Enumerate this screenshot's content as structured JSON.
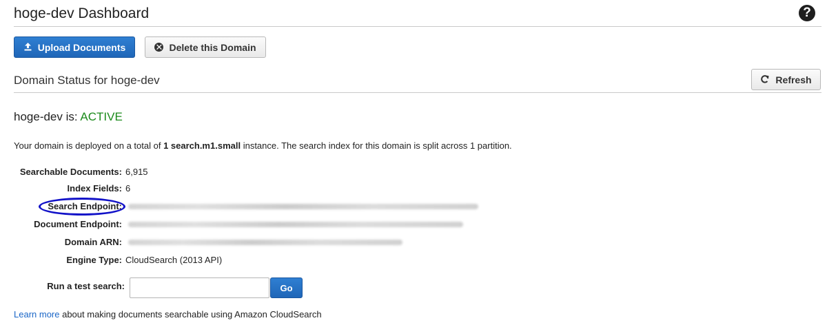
{
  "header": {
    "title": "hoge-dev Dashboard",
    "help_icon": "?"
  },
  "toolbar": {
    "upload_label": "Upload Documents",
    "delete_label": "Delete this Domain",
    "upload_icon": "upload-icon",
    "delete_icon": "circle-x-icon"
  },
  "domain_status": {
    "section_title": "Domain Status for hoge-dev",
    "refresh_label": "Refresh",
    "status_prefix": "hoge-dev is:",
    "status_value": "ACTIVE",
    "status_color": "#1a8a1a"
  },
  "summary": {
    "part1": "Your domain is deployed on a total of ",
    "instance": "1 search.m1.small",
    "part2": " instance. The search index for this domain is split across 1 partition."
  },
  "details": [
    {
      "label": "Searchable Documents:",
      "value": "6,915"
    },
    {
      "label": "Index Fields:",
      "value": "6"
    },
    {
      "label": "Search Endpoint:",
      "value": ""
    },
    {
      "label": "Document Endpoint:",
      "value": ""
    },
    {
      "label": "Domain ARN:",
      "value": ""
    },
    {
      "label": "Engine Type:",
      "value": "CloudSearch (2013 API)"
    }
  ],
  "test_search": {
    "label": "Run a test search:",
    "placeholder": "",
    "go_label": "Go"
  },
  "footer": {
    "link_text": "Learn more",
    "text": " about making documents searchable using Amazon CloudSearch"
  },
  "colors": {
    "primary": "#1f66b8",
    "link": "#1a66c7",
    "annotation": "#1212c8"
  }
}
